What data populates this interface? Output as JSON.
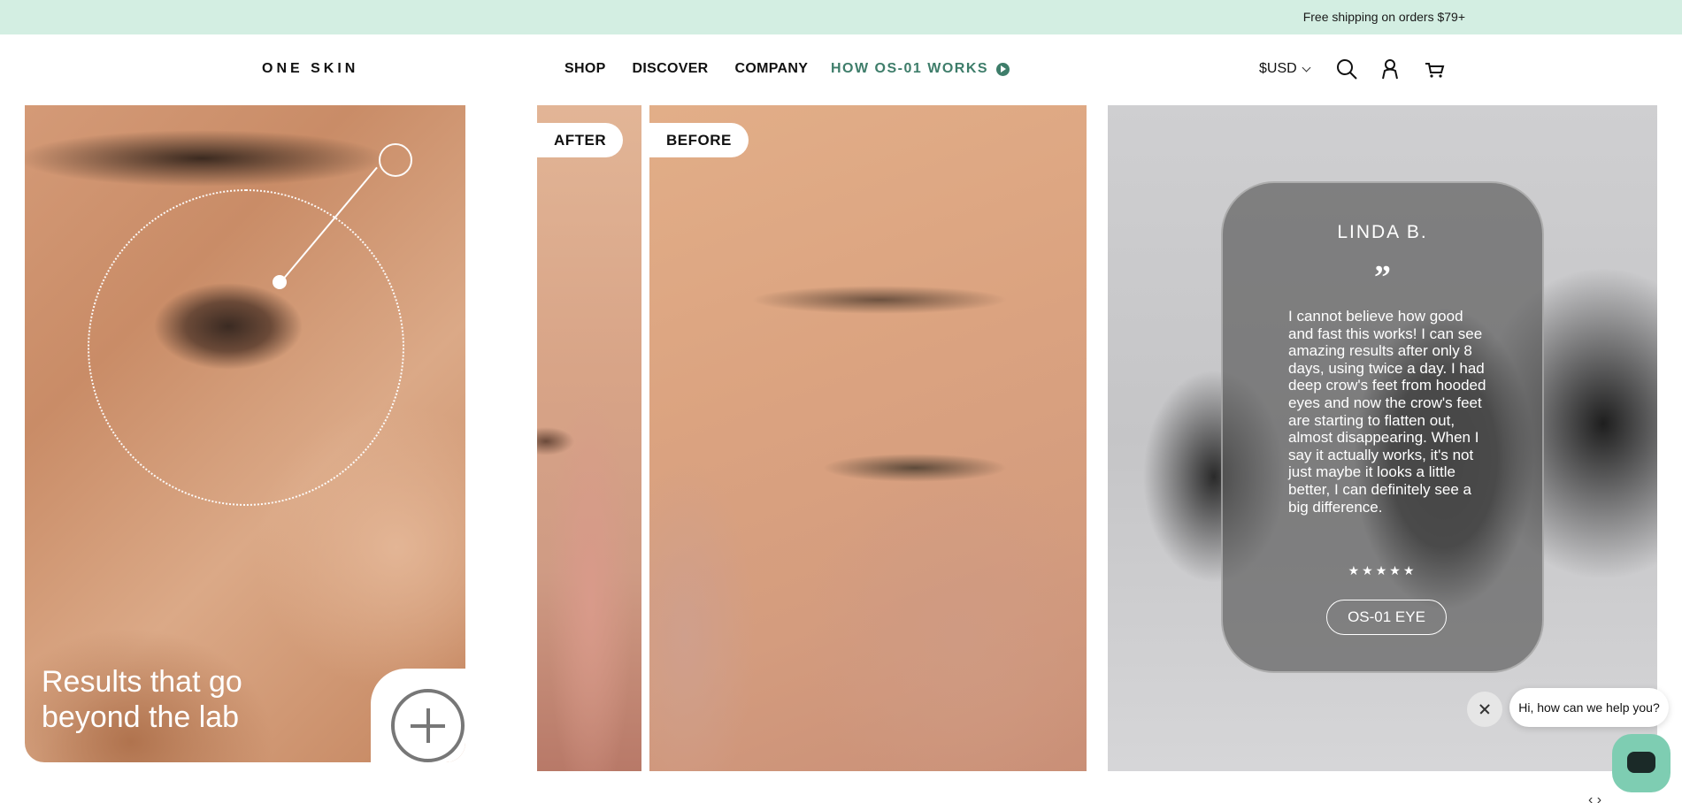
{
  "announcement": {
    "text": "Free shipping on orders $79+"
  },
  "header": {
    "logo": "ONE SKIN",
    "nav": [
      "SHOP",
      "DISCOVER",
      "COMPANY"
    ],
    "how_it_works": "HOW OS-01 WORKS",
    "currency": "$USD",
    "icons": [
      "search-icon",
      "account-icon",
      "cart-icon"
    ]
  },
  "panels": {
    "lab": {
      "title": "Results that go beyond the lab"
    },
    "comparison": {
      "after_label": "AFTER",
      "before_label": "BEFORE"
    },
    "review": {
      "reviewer": "LINDA B.",
      "quote_mark": "”",
      "text": "I cannot believe how good and fast this works! I can see amazing results after only 8 days, using twice a day. I had deep crow's feet from hooded eyes and now the crow's feet are starting to flatten out, almost disappearing. When I say it actually works, it's not just maybe it looks a little better, I can definitely see a big difference.",
      "stars": "★★★★★",
      "rating": 5,
      "product": "OS-01 EYE"
    }
  },
  "chat": {
    "greeting": "Hi, how can we help you?"
  },
  "carousel": {
    "arrows": "‹  ›"
  },
  "colors": {
    "announce_bg": "#d3eee2",
    "accent_green": "#3e7d6a",
    "chat_launcher": "#7ecdb2"
  }
}
